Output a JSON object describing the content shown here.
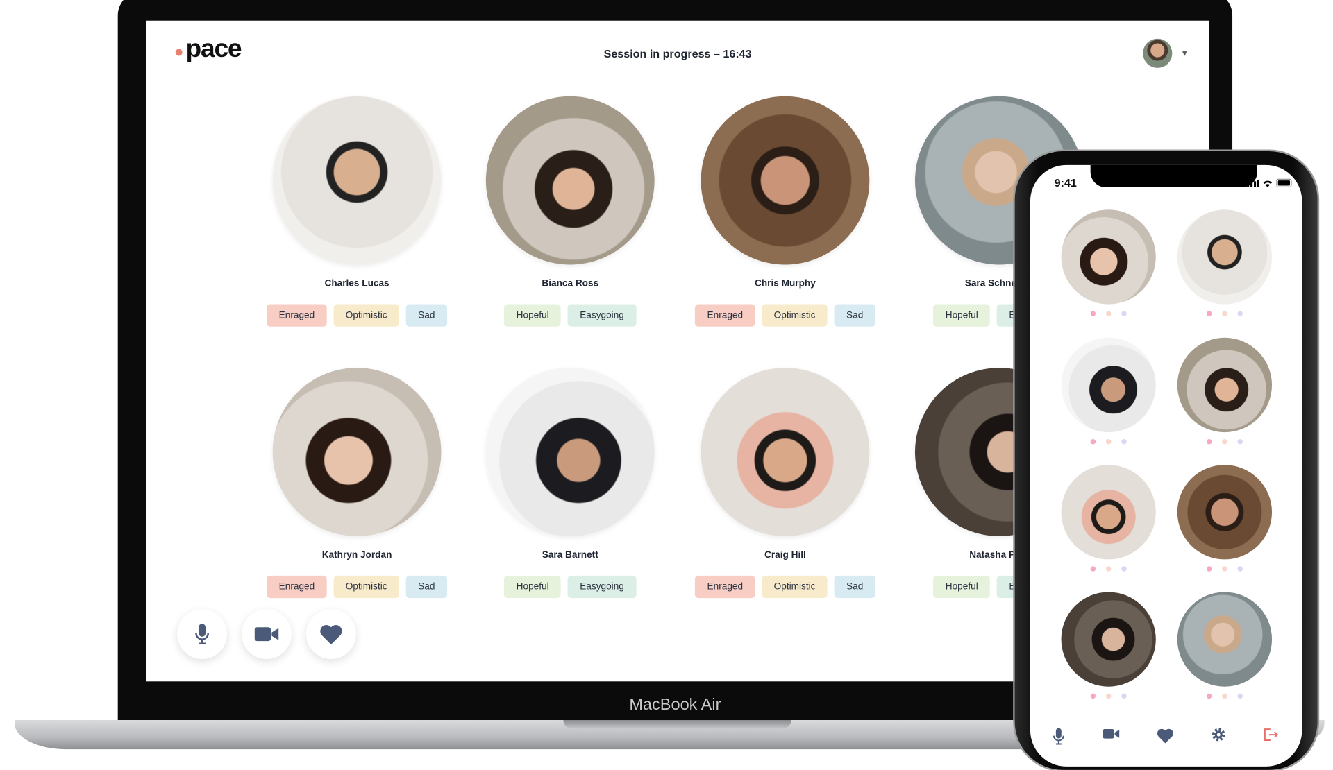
{
  "laptop": {
    "device_label": "MacBook Air",
    "logo": "pace",
    "session_status": "Session in progress – 16:43",
    "participants": [
      {
        "name": "Charles Lucas",
        "tags": [
          "Enraged",
          "Optimistic",
          "Sad"
        ]
      },
      {
        "name": "Bianca Ross",
        "tags": [
          "Hopeful",
          "Easygoing"
        ]
      },
      {
        "name": "Chris Murphy",
        "tags": [
          "Enraged",
          "Optimistic",
          "Sad"
        ]
      },
      {
        "name": "Sara Schneider",
        "tags": [
          "Hopeful",
          "Easygoing"
        ]
      },
      {
        "name": "Kathryn Jordan",
        "tags": [
          "Enraged",
          "Optimistic",
          "Sad"
        ]
      },
      {
        "name": "Sara Barnett",
        "tags": [
          "Hopeful",
          "Easygoing"
        ]
      },
      {
        "name": "Craig Hill",
        "tags": [
          "Enraged",
          "Optimistic",
          "Sad"
        ]
      },
      {
        "name": "Natasha Park",
        "tags": [
          "Hopeful",
          "Easygoing"
        ]
      }
    ],
    "controls": [
      "microphone-icon",
      "video-camera-icon",
      "heart-icon"
    ]
  },
  "phone": {
    "status_time": "9:41",
    "tile_count": 8,
    "toolbar": [
      "microphone-icon",
      "video-camera-icon",
      "heart-icon",
      "gear-icon",
      "exit-icon"
    ]
  },
  "colors": {
    "brand_dot": "#e8806e",
    "icon": "#4a5a78",
    "exit": "#e8706a",
    "tags": {
      "Enraged": "#f8cdc4",
      "Optimistic": "#f8ebcc",
      "Sad": "#d8ebf3",
      "Hopeful": "#e6f2dc",
      "Easygoing": "#dcefe6"
    }
  }
}
